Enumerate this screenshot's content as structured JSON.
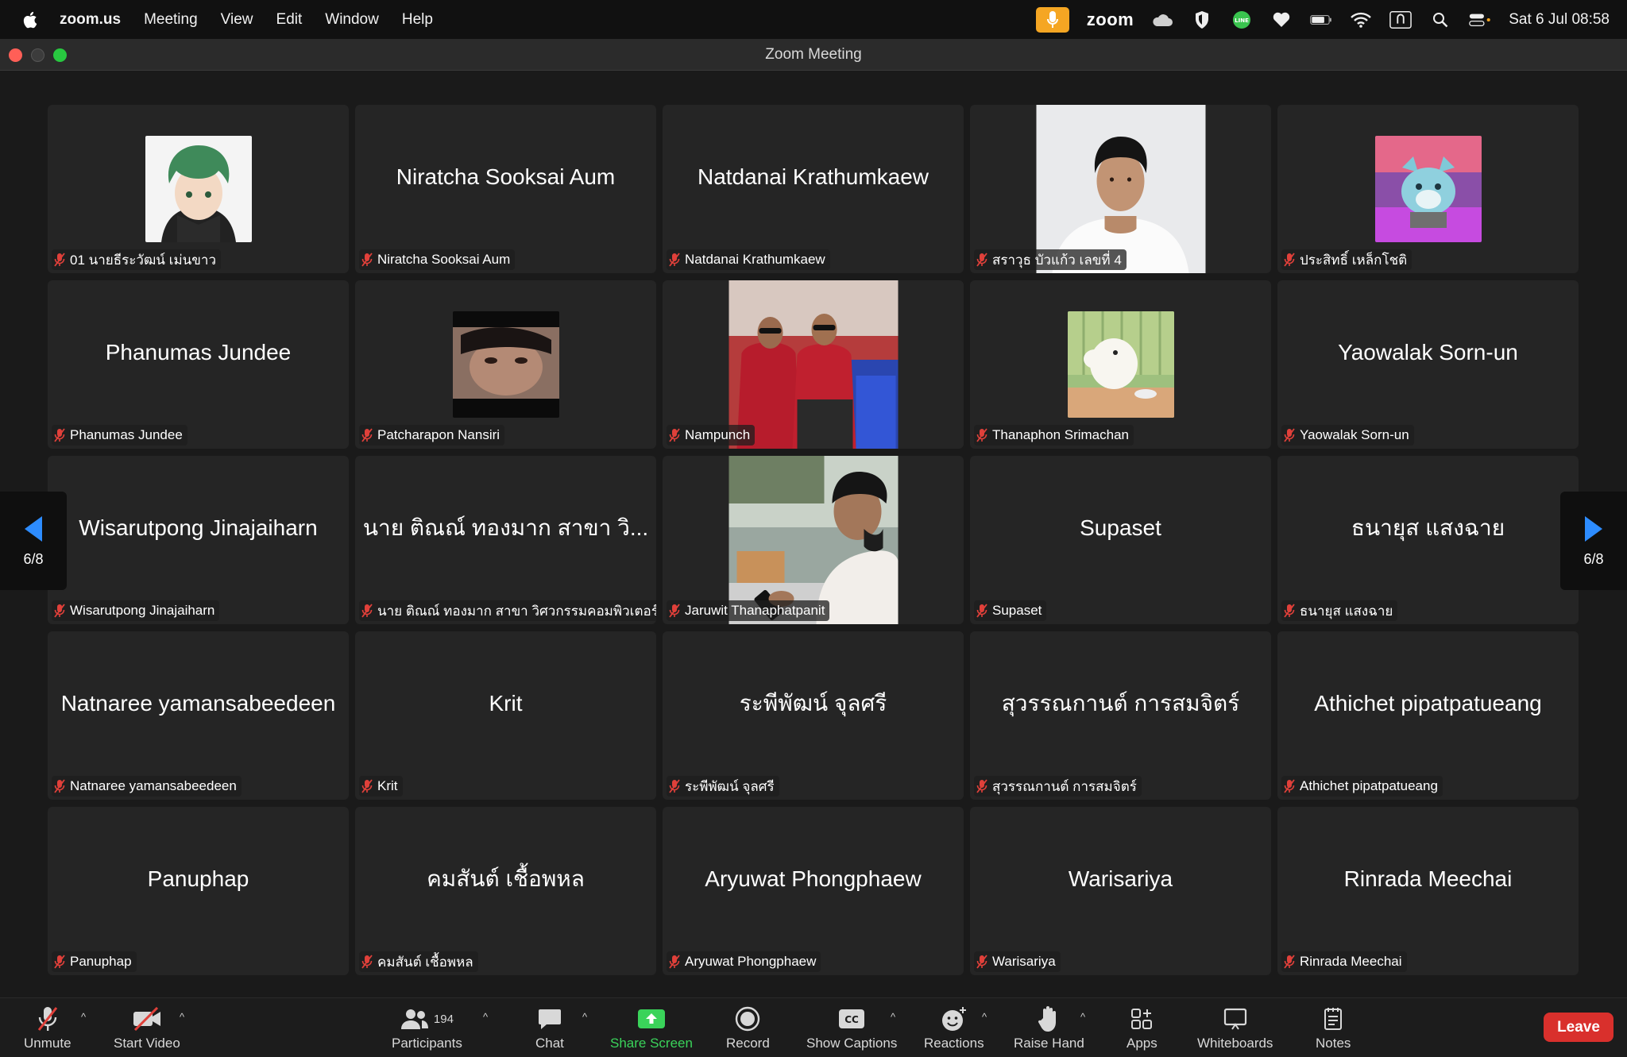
{
  "menubar": {
    "app_name": "zoom.us",
    "menus": [
      "Meeting",
      "View",
      "Edit",
      "Window",
      "Help"
    ],
    "zoom_word": "zoom",
    "clock": "Sat 6 Jul  08:58"
  },
  "window": {
    "title": "Zoom Meeting"
  },
  "page_nav": {
    "page_label": "6/8"
  },
  "participants": [
    {
      "name": "01 นายธีระวัฒน์ เม่นขาว",
      "display": "",
      "media": "avatar-anime"
    },
    {
      "name": "Niratcha Sooksai Aum",
      "display": "Niratcha Sooksai Aum",
      "media": "none"
    },
    {
      "name": "Natdanai Krathumkaew",
      "display": "Natdanai Krathumkaew",
      "media": "none"
    },
    {
      "name": "สราวุธ บัวแก้ว เลขที่ 4",
      "display": "",
      "media": "video-portrait"
    },
    {
      "name": "ประสิทธิ์ เหล็กโชติ",
      "display": "",
      "media": "avatar-dog"
    },
    {
      "name": "Phanumas Jundee",
      "display": "Phanumas Jundee",
      "media": "none"
    },
    {
      "name": "Patcharapon Nansiri",
      "display": "",
      "media": "avatar-face"
    },
    {
      "name": "Nampunch",
      "display": "",
      "media": "video-two-men"
    },
    {
      "name": "Thanaphon Srimachan",
      "display": "",
      "media": "avatar-moomin"
    },
    {
      "name": "Yaowalak Sorn-un",
      "display": "Yaowalak Sorn-un",
      "media": "none"
    },
    {
      "name": "Wisarutpong Jinajaiharn",
      "display": "Wisarutpong Jinajaiharn",
      "media": "none"
    },
    {
      "name": "นาย ติณณ์ ทองมาก สาขา วิศวกรรมคอมพิวเตอร์",
      "display": "นาย ติณณ์ ทองมาก สาขา วิ...",
      "media": "none"
    },
    {
      "name": "Jaruwit Thanaphatpanit",
      "display": "",
      "media": "video-phone"
    },
    {
      "name": "Supaset",
      "display": "Supaset",
      "media": "none"
    },
    {
      "name": "ธนายุส แสงฉาย",
      "display": "ธนายุส แสงฉาย",
      "media": "none"
    },
    {
      "name": "Natnaree yamansabeedeen",
      "display": "Natnaree yamansabeedeen",
      "media": "none"
    },
    {
      "name": "Krit",
      "display": "Krit",
      "media": "none"
    },
    {
      "name": "ระพีพัฒน์ จุลศรี",
      "display": "ระพีพัฒน์ จุลศรี",
      "media": "none"
    },
    {
      "name": "สุวรรณกานต์ การสมจิตร์",
      "display": "สุวรรณกานต์ การสมจิตร์",
      "media": "none"
    },
    {
      "name": "Athichet pipatpatueang",
      "display": "Athichet pipatpatueang",
      "media": "none"
    },
    {
      "name": "Panuphap",
      "display": "Panuphap",
      "media": "none"
    },
    {
      "name": "คมสันต์ เชื้อพหล",
      "display": "คมสันต์ เชื้อพหล",
      "media": "none"
    },
    {
      "name": "Aryuwat Phongphaew",
      "display": "Aryuwat Phongphaew",
      "media": "none"
    },
    {
      "name": "Warisariya",
      "display": "Warisariya",
      "media": "none"
    },
    {
      "name": "Rinrada Meechai",
      "display": "Rinrada Meechai",
      "media": "none"
    }
  ],
  "toolbar": {
    "unmute": "Unmute",
    "start_video": "Start Video",
    "participants": "Participants",
    "participant_count": "194",
    "chat": "Chat",
    "share_screen": "Share Screen",
    "record": "Record",
    "show_captions": "Show Captions",
    "reactions": "Reactions",
    "raise_hand": "Raise Hand",
    "apps": "Apps",
    "whiteboards": "Whiteboards",
    "notes": "Notes",
    "leave": "Leave"
  },
  "colors": {
    "share_green": "#3ad35a",
    "leave_red": "#d9302c",
    "mic_muted_red": "#e0403a",
    "mic_pill": "#f5a623"
  }
}
